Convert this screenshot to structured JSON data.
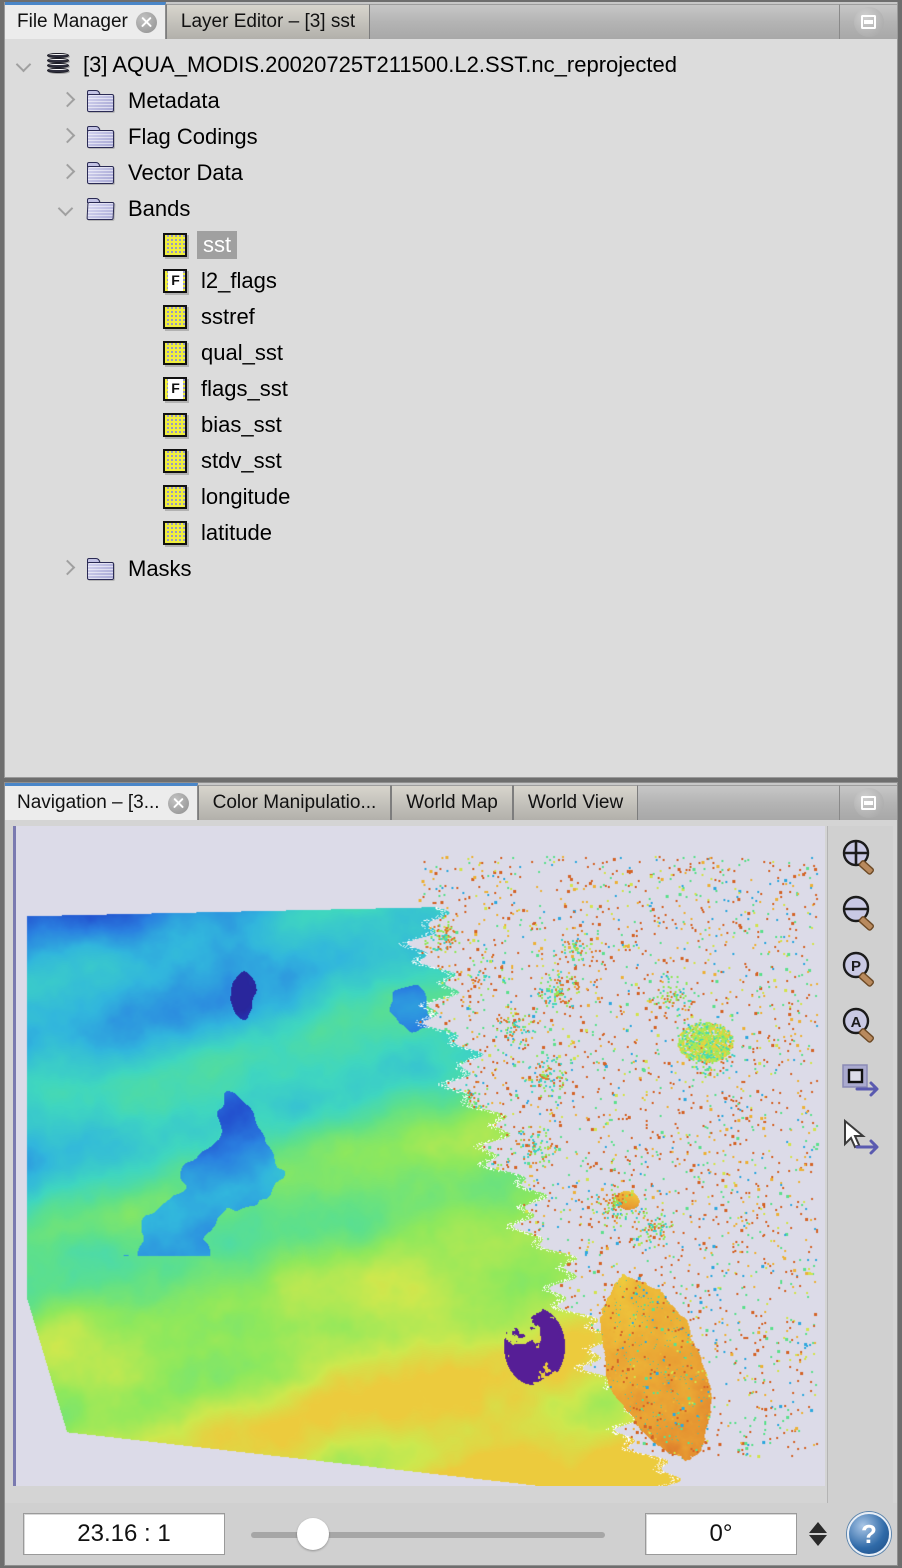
{
  "top_panel": {
    "tabs": [
      {
        "label": "File Manager",
        "active": true,
        "closable": true
      },
      {
        "label": "Layer Editor – [3] sst",
        "active": false,
        "closable": false
      }
    ],
    "float_button": "float-window-icon",
    "tree": [
      {
        "label": "[3] AQUA_MODIS.20020725T211500.L2.SST.nc_reprojected",
        "icon": "product",
        "twist": "down",
        "depth": 0,
        "selected": false
      },
      {
        "label": "Metadata",
        "icon": "folder",
        "twist": "right",
        "depth": 1,
        "selected": false
      },
      {
        "label": "Flag Codings",
        "icon": "folder",
        "twist": "right",
        "depth": 1,
        "selected": false
      },
      {
        "label": "Vector Data",
        "icon": "folder",
        "twist": "right",
        "depth": 1,
        "selected": false
      },
      {
        "label": "Bands",
        "icon": "folder-open",
        "twist": "down",
        "depth": 1,
        "selected": false
      },
      {
        "label": "sst",
        "icon": "band",
        "twist": "none",
        "depth": 2,
        "selected": true
      },
      {
        "label": "l2_flags",
        "icon": "flag",
        "twist": "none",
        "depth": 2,
        "selected": false
      },
      {
        "label": "sstref",
        "icon": "band",
        "twist": "none",
        "depth": 2,
        "selected": false
      },
      {
        "label": "qual_sst",
        "icon": "band",
        "twist": "none",
        "depth": 2,
        "selected": false
      },
      {
        "label": "flags_sst",
        "icon": "flag",
        "twist": "none",
        "depth": 2,
        "selected": false
      },
      {
        "label": "bias_sst",
        "icon": "band",
        "twist": "none",
        "depth": 2,
        "selected": false
      },
      {
        "label": "stdv_sst",
        "icon": "band",
        "twist": "none",
        "depth": 2,
        "selected": false
      },
      {
        "label": "longitude",
        "icon": "band",
        "twist": "none",
        "depth": 2,
        "selected": false
      },
      {
        "label": "latitude",
        "icon": "band",
        "twist": "none",
        "depth": 2,
        "selected": false
      },
      {
        "label": "Masks",
        "icon": "folder",
        "twist": "right",
        "depth": 1,
        "selected": false
      }
    ]
  },
  "bottom_panel": {
    "tabs": [
      {
        "label": "Navigation – [3...",
        "active": true,
        "closable": true
      },
      {
        "label": "Color Manipulatio...",
        "active": false,
        "closable": false
      },
      {
        "label": "World Map",
        "active": false,
        "closable": false
      },
      {
        "label": "World View",
        "active": false,
        "closable": false
      }
    ],
    "float_button": "float-window-icon",
    "toolbar": [
      {
        "name": "zoom-in-icon",
        "glyph": "+"
      },
      {
        "name": "zoom-out-icon",
        "glyph": "−"
      },
      {
        "name": "zoom-pixel-icon",
        "glyph": "P"
      },
      {
        "name": "zoom-all-icon",
        "glyph": "A"
      },
      {
        "name": "sync-views-icon",
        "glyph": ""
      },
      {
        "name": "sync-cursors-icon",
        "glyph": ""
      }
    ],
    "status": {
      "zoom_ratio": "23.16 : 1",
      "slider_percent": 13,
      "rotation": "0°",
      "help_label": "?"
    },
    "image": {
      "title": "sst",
      "background_color": "#dcdbe8",
      "palette": [
        "#2b1f8f",
        "#2040c8",
        "#2a7fe0",
        "#31b6dd",
        "#3fd6c0",
        "#5ee08a",
        "#8fe85c",
        "#cde84e",
        "#efc93c",
        "#e9a033",
        "#d86a28",
        "#b5361f"
      ]
    }
  }
}
